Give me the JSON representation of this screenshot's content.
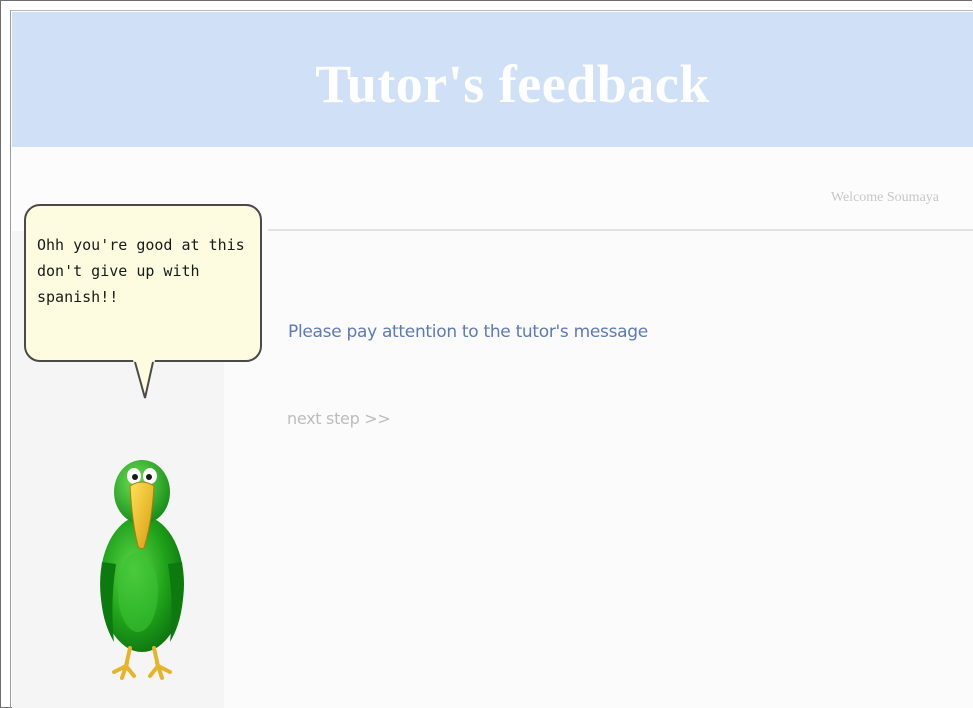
{
  "header": {
    "title": "Tutor's feedback",
    "background_color": "#cfe0f7"
  },
  "user": {
    "welcome_text": "Welcome Soumaya"
  },
  "tutor": {
    "speech_lines": [
      "Ohh you're good at this",
      "don't give up with",
      "spanish!!"
    ],
    "avatar_icon": "green-parrot-icon",
    "bubble_color": "#fdfce1"
  },
  "main": {
    "message": "Please pay attention to the tutor's message",
    "next_step_label": "next step >>",
    "message_color": "#5d7ab8"
  }
}
